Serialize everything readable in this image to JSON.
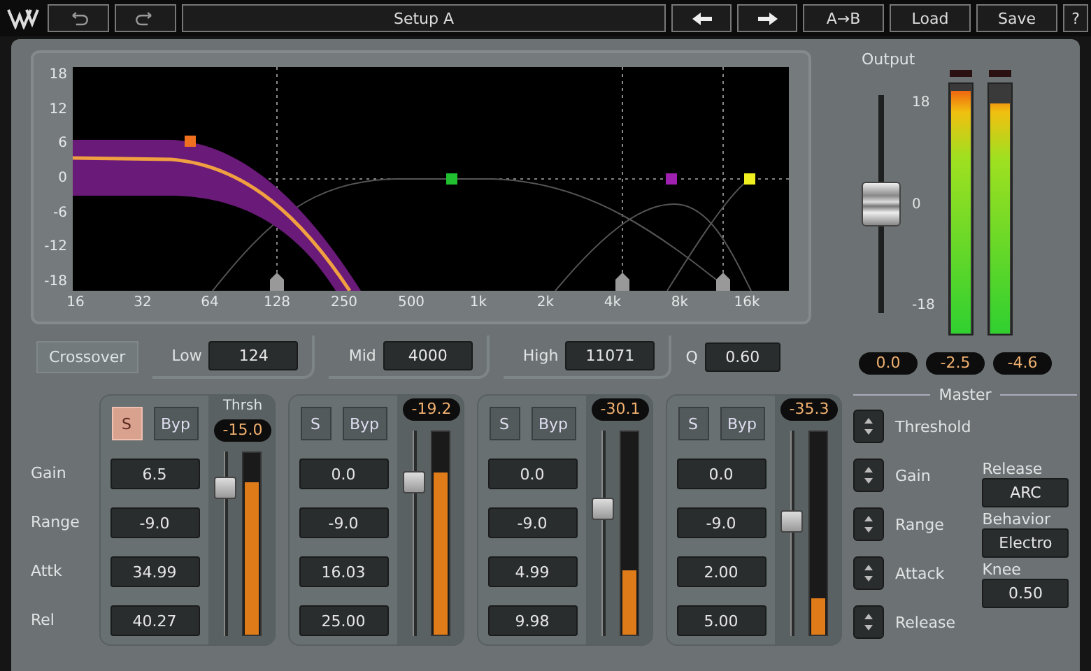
{
  "toolbar": {
    "preset": "Setup A",
    "buttons": [
      {
        "label": "A→B"
      },
      {
        "label": "Load"
      },
      {
        "label": "Save"
      },
      {
        "label": "?"
      }
    ]
  },
  "graph": {
    "y_labels": [
      "18",
      "12",
      "6",
      "0",
      "-6",
      "-12",
      "-18"
    ],
    "x_labels": [
      "16",
      "32",
      "64",
      "128",
      "250",
      "500",
      "1k",
      "2k",
      "4k",
      "8k",
      "16k"
    ]
  },
  "output": {
    "label": "Output",
    "scale": [
      "18",
      "0",
      "-18"
    ],
    "fader": {
      "level": 0.5,
      "reading": "0.0"
    },
    "meters": [
      {
        "level": 0.97,
        "reading": "-2.5"
      },
      {
        "level": 0.92,
        "reading": "-4.6"
      }
    ]
  },
  "crossover": {
    "label": "Crossover",
    "fields": [
      {
        "label": "Low",
        "value": "124"
      },
      {
        "label": "Mid",
        "value": "4000"
      },
      {
        "label": "High",
        "value": "11071"
      },
      {
        "label": "Q",
        "value": "0.60"
      }
    ]
  },
  "bands": {
    "row_labels": [
      "Gain",
      "Range",
      "Attk",
      "Rel"
    ],
    "thresh_label": "Thrsh",
    "items": [
      {
        "solo": {
          "label": "S",
          "on": true
        },
        "bypass": {
          "label": "Byp",
          "on": false
        },
        "threshold": "-15.0",
        "threshold_slider": {
          "level": 0.8
        },
        "gain_reduction": {
          "level": 0.84
        },
        "values": [
          "6.5",
          "-9.0",
          "34.99",
          "40.27"
        ]
      },
      {
        "solo": {
          "label": "S",
          "on": false
        },
        "bypass": {
          "label": "Byp",
          "on": false
        },
        "threshold": "-19.2",
        "threshold_slider": {
          "level": 0.75
        },
        "gain_reduction": {
          "level": 0.8
        },
        "values": [
          "0.0",
          "-9.0",
          "16.03",
          "25.00"
        ]
      },
      {
        "solo": {
          "label": "S",
          "on": false
        },
        "bypass": {
          "label": "Byp",
          "on": false
        },
        "threshold": "-30.1",
        "threshold_slider": {
          "level": 0.62
        },
        "gain_reduction": {
          "level": 0.32
        },
        "values": [
          "0.0",
          "-9.0",
          "4.99",
          "9.98"
        ]
      },
      {
        "solo": {
          "label": "S",
          "on": false
        },
        "bypass": {
          "label": "Byp",
          "on": false
        },
        "threshold": "-35.3",
        "threshold_slider": {
          "level": 0.56
        },
        "gain_reduction": {
          "level": 0.18
        },
        "values": [
          "0.0",
          "-9.0",
          "2.00",
          "5.00"
        ]
      }
    ]
  },
  "master": {
    "title": "Master",
    "items": [
      "Threshold",
      "Gain",
      "Range",
      "Attack",
      "Release"
    ],
    "settings": [
      {
        "label": "Release",
        "value": "ARC"
      },
      {
        "label": "Behavior",
        "value": "Electro"
      },
      {
        "label": "Knee",
        "value": "0.50"
      }
    ]
  }
}
